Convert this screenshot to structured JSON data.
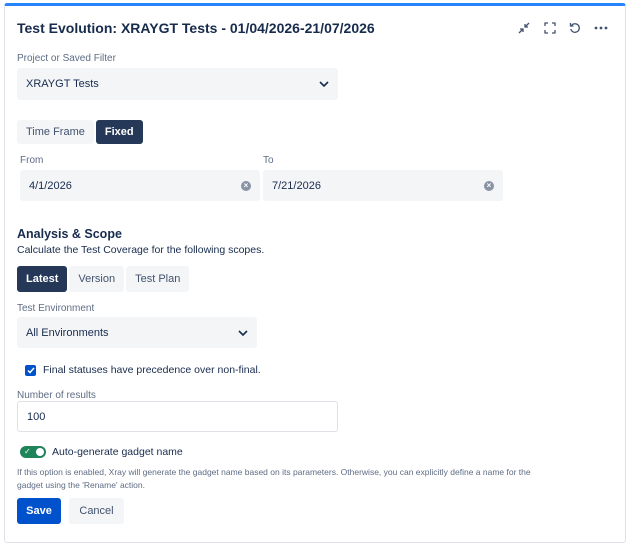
{
  "header": {
    "title": "Test Evolution: XRAYGT Tests - 01/04/2026-21/07/2026",
    "icons": [
      "minimize-icon",
      "fullscreen-icon",
      "refresh-icon",
      "more-icon"
    ]
  },
  "project": {
    "label": "Project or Saved Filter",
    "value": "XRAYGT Tests"
  },
  "period_tabs": {
    "time_frame": "Time Frame",
    "fixed": "Fixed",
    "selected": "Fixed"
  },
  "dates": {
    "from_label": "From",
    "from_value": "4/1/2026",
    "to_label": "To",
    "to_value": "7/21/2026"
  },
  "analysis": {
    "heading": "Analysis & Scope",
    "description": "Calculate the Test Coverage for the following scopes.",
    "tabs": [
      "Latest",
      "Version",
      "Test Plan"
    ],
    "selected": "Latest"
  },
  "environment": {
    "label": "Test Environment",
    "value": "All Environments"
  },
  "final_statuses": {
    "label": "Final statuses have precedence over non-final.",
    "checked": true
  },
  "results": {
    "label": "Number of results",
    "value": "100"
  },
  "auto_name": {
    "label": "Auto-generate gadget name",
    "enabled": true,
    "note_line1": "If this option is enabled, Xray will generate the gadget name based on its parameters. Otherwise, you can explicitly define a name for the",
    "note_line2": "gadget using the 'Rename' action."
  },
  "actions": {
    "save": "Save",
    "cancel": "Cancel"
  },
  "colors": {
    "accent": "#0052cc",
    "dark_selected": "#253858",
    "toggle_on": "#1f845a",
    "top_border": "#2684ff"
  }
}
